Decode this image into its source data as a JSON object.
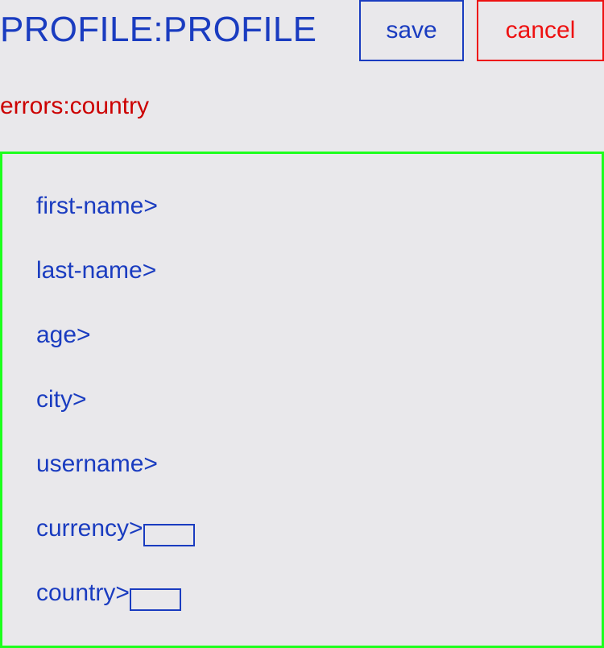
{
  "header": {
    "title": "PROFILE:PROFILE",
    "save_label": "save",
    "cancel_label": "cancel"
  },
  "errors": {
    "text": "errors:country"
  },
  "form": {
    "fields": [
      {
        "label": "first-name>"
      },
      {
        "label": "last-name>"
      },
      {
        "label": "age>"
      },
      {
        "label": "city>"
      },
      {
        "label": "username>"
      },
      {
        "label": "currency>",
        "value": ""
      },
      {
        "label": "country>",
        "value": ""
      }
    ]
  },
  "colors": {
    "primary_text": "#1a3cc0",
    "cancel": "#ee1111",
    "error": "#cc0000",
    "panel_border": "#1dff1d",
    "background": "#e9e8eb"
  }
}
